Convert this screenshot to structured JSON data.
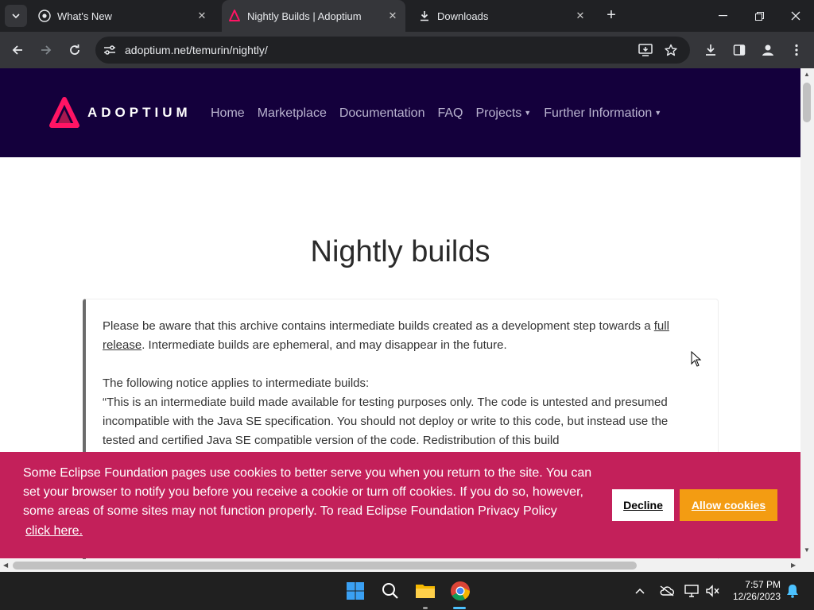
{
  "tabs": [
    {
      "title": "What's New",
      "icon": "chrome-icon"
    },
    {
      "title": "Nightly Builds | Adoptium",
      "icon": "adoptium-icon",
      "active": true
    },
    {
      "title": "Downloads",
      "icon": "download-icon"
    }
  ],
  "address": {
    "url": "adoptium.net/temurin/nightly/"
  },
  "site": {
    "logo_text": "ADOPTIUM",
    "nav": {
      "home": "Home",
      "marketplace": "Marketplace",
      "documentation": "Documentation",
      "faq": "FAQ",
      "projects": "Projects",
      "further_information": "Further Information"
    },
    "heading": "Nightly builds",
    "notice": {
      "p1_before": "Please be aware that this archive contains intermediate builds created as a development step towards a ",
      "p1_link": "full release",
      "p1_after": ". Intermediate builds are ephemeral, and may disappear in the future.",
      "p2_intro": "The following notice applies to intermediate builds:",
      "p2_quote": "“This is an intermediate build made available for testing purposes only. The code is untested and presumed incompatible with the Java SE specification. You should not deploy or write to this code, but instead use the tested and certified Java SE compatible version of the code. Redistribution of this build"
    }
  },
  "cookie_banner": {
    "text": "Some Eclipse Foundation pages use cookies to better serve you when you return to the site. You can set your browser to notify you before you receive a cookie or turn off cookies. If you do so, however, some areas of some sites may not function properly. To read Eclipse Foundation Privacy Policy",
    "link": "click here.",
    "decline": "Decline",
    "allow": "Allow cookies",
    "color": "#c3205a",
    "allow_color": "#f39c12"
  },
  "taskbar": {
    "time": "7:57 PM",
    "date": "12/26/2023"
  },
  "colors": {
    "site_nav_bg": "#14003c",
    "brand": "#ff1464"
  }
}
